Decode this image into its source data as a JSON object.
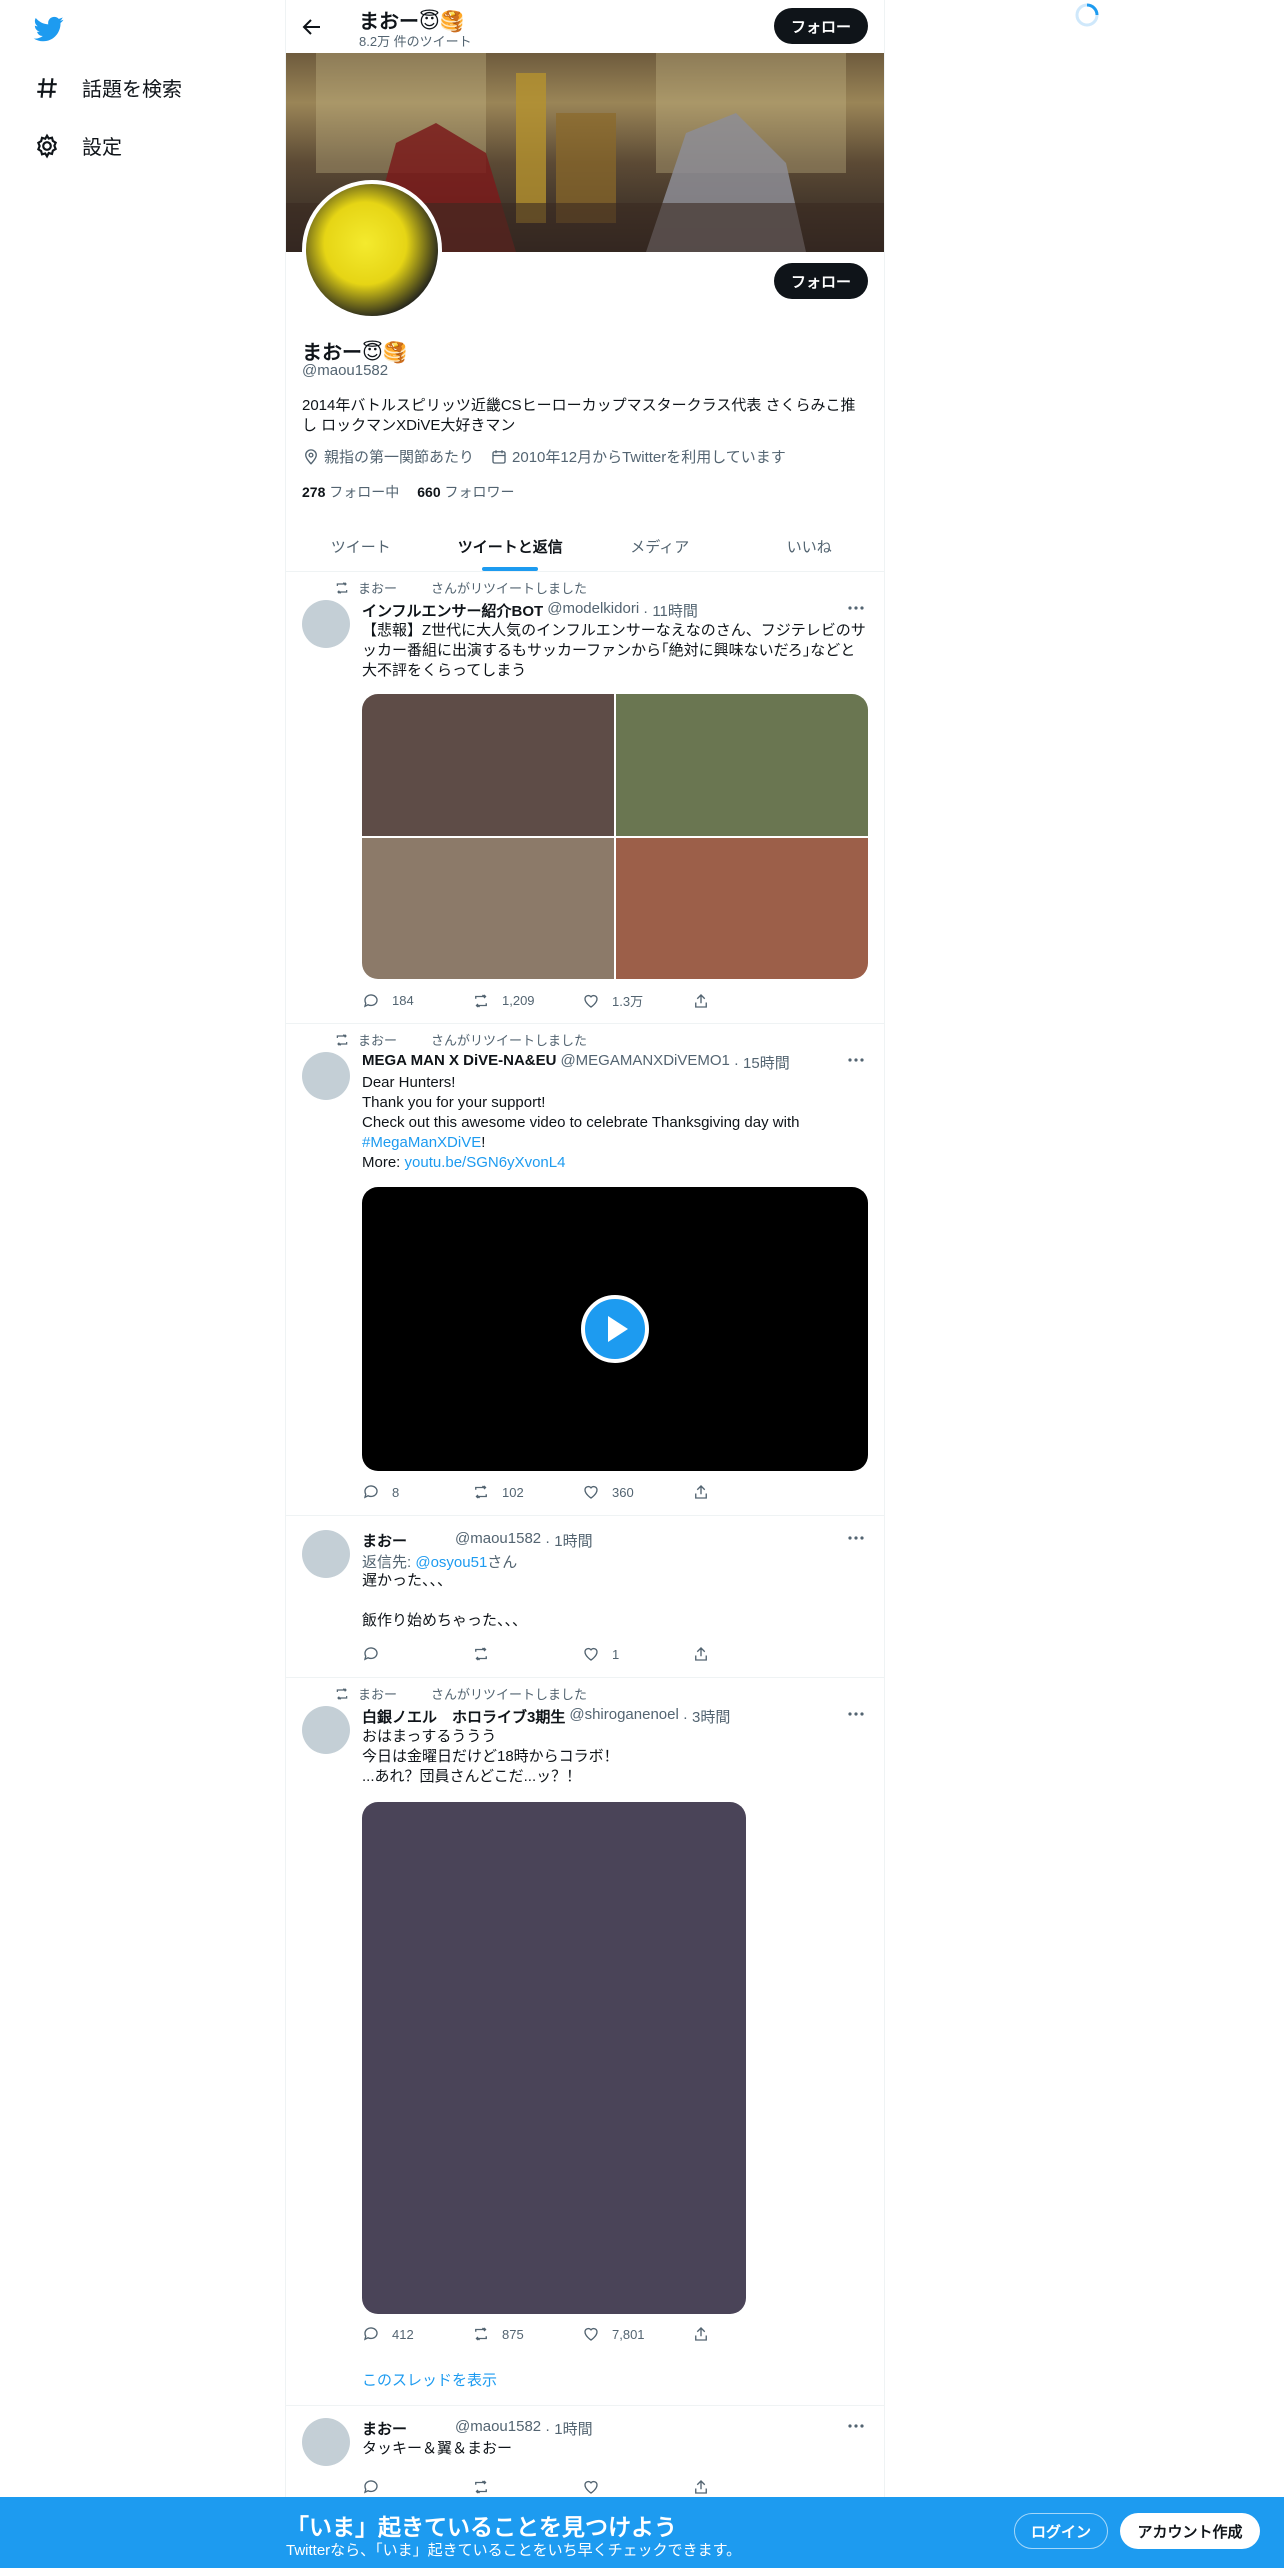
{
  "nav": {
    "items": [
      {
        "label": "話題を検索",
        "icon": "hashtag-icon"
      },
      {
        "label": "設定",
        "icon": "gear-icon"
      }
    ]
  },
  "header": {
    "name": "まおー😇🥞",
    "tweet_count": "8.2万 件のツイート",
    "follow_label": "フォロー"
  },
  "profile": {
    "name": "まおー😇🥞",
    "handle": "@maou1582",
    "follow_label": "フォロー",
    "bio": "2014年バトルスピリッツ近畿CSヒーローカップマスタークラス代表 さくらみこ推し ロックマンXDiVE大好きマン",
    "location": "親指の第一関節あたり",
    "joined": "2010年12月からTwitterを利用しています",
    "following_count": "278",
    "following_label": "フォロー中",
    "followers_count": "660",
    "followers_label": "フォロワー"
  },
  "tabs": [
    "ツイート",
    "ツイートと返信",
    "メディア",
    "いいね"
  ],
  "tweets": [
    {
      "rt_by": "まおー",
      "rt_suffix": "さんがリツイートしました",
      "display_name": "インフルエンサー紹介BOT",
      "handle": "@modelkidori",
      "time": "· 11時間",
      "text": "【悲報】Z世代に大人気のインフルエンサーなえなのさん、フジテレビのサッカー番組に出演するもサッカーファンから｢絶対に興味ないだろ｣などと大不評をくらってしまう",
      "replies": "184",
      "retweets": "1,209",
      "likes": "1.3万"
    },
    {
      "rt_by": "まおー",
      "rt_suffix": "さんがリツイートしました",
      "display_name": "MEGA MAN X DiVE-NA&EU",
      "handle": "@MEGAMANXDiVEMO1",
      "time": "· 15時間",
      "text_lines": [
        "Dear Hunters!",
        "Thank you for your support!",
        "Check out this awesome video to celebrate Thanksgiving day with"
      ],
      "hashtag": "#MegaManXDiVE",
      "hashtag_suffix": "!",
      "more_label": "More:",
      "link": "youtu.be/SGN6yXvonL4",
      "replies": "8",
      "retweets": "102",
      "likes": "360"
    },
    {
      "display_name": "まおー",
      "handle": "@maou1582",
      "time": "· 1時間",
      "reply_prefix": "返信先:",
      "reply_to": "@osyou51",
      "reply_suffix": "さん",
      "text": "遅かった、、、\n\n飯作り始めちゃった、、、",
      "likes": "1"
    },
    {
      "rt_by": "まおー",
      "rt_suffix": "さんがリツイートしました",
      "display_name": "白銀ノエル　ホロライブ3期生",
      "handle": "@shiroganenoel",
      "time": "· 3時間",
      "text": "おはまっするううう\n今日は金曜日だけど18時からコラボ！\n...あれ？団員さんどこだ...ッ？！",
      "replies": "412",
      "retweets": "875",
      "likes": "7,801",
      "thread_label": "このスレッドを表示"
    },
    {
      "display_name": "まおー",
      "handle": "@maou1582",
      "time": "· 1時間",
      "text": "タッキー＆翼＆まおー"
    }
  ],
  "bottom_bar": {
    "title": "「いま」起きていることを見つけよう",
    "subtitle": "Twitterなら、「いま」起きていることをいち早くチェックできます。",
    "login_label": "ログイン",
    "signup_label": "アカウント作成"
  },
  "colors": {
    "accent": "#1d9bf0",
    "text": "#0f1419",
    "muted": "#536471",
    "media_1": "#5e4c47",
    "media_2": "#6a7651",
    "media_3": "#8c7a69",
    "media_4": "#9c5f49",
    "media_noel": "#4a4458"
  }
}
